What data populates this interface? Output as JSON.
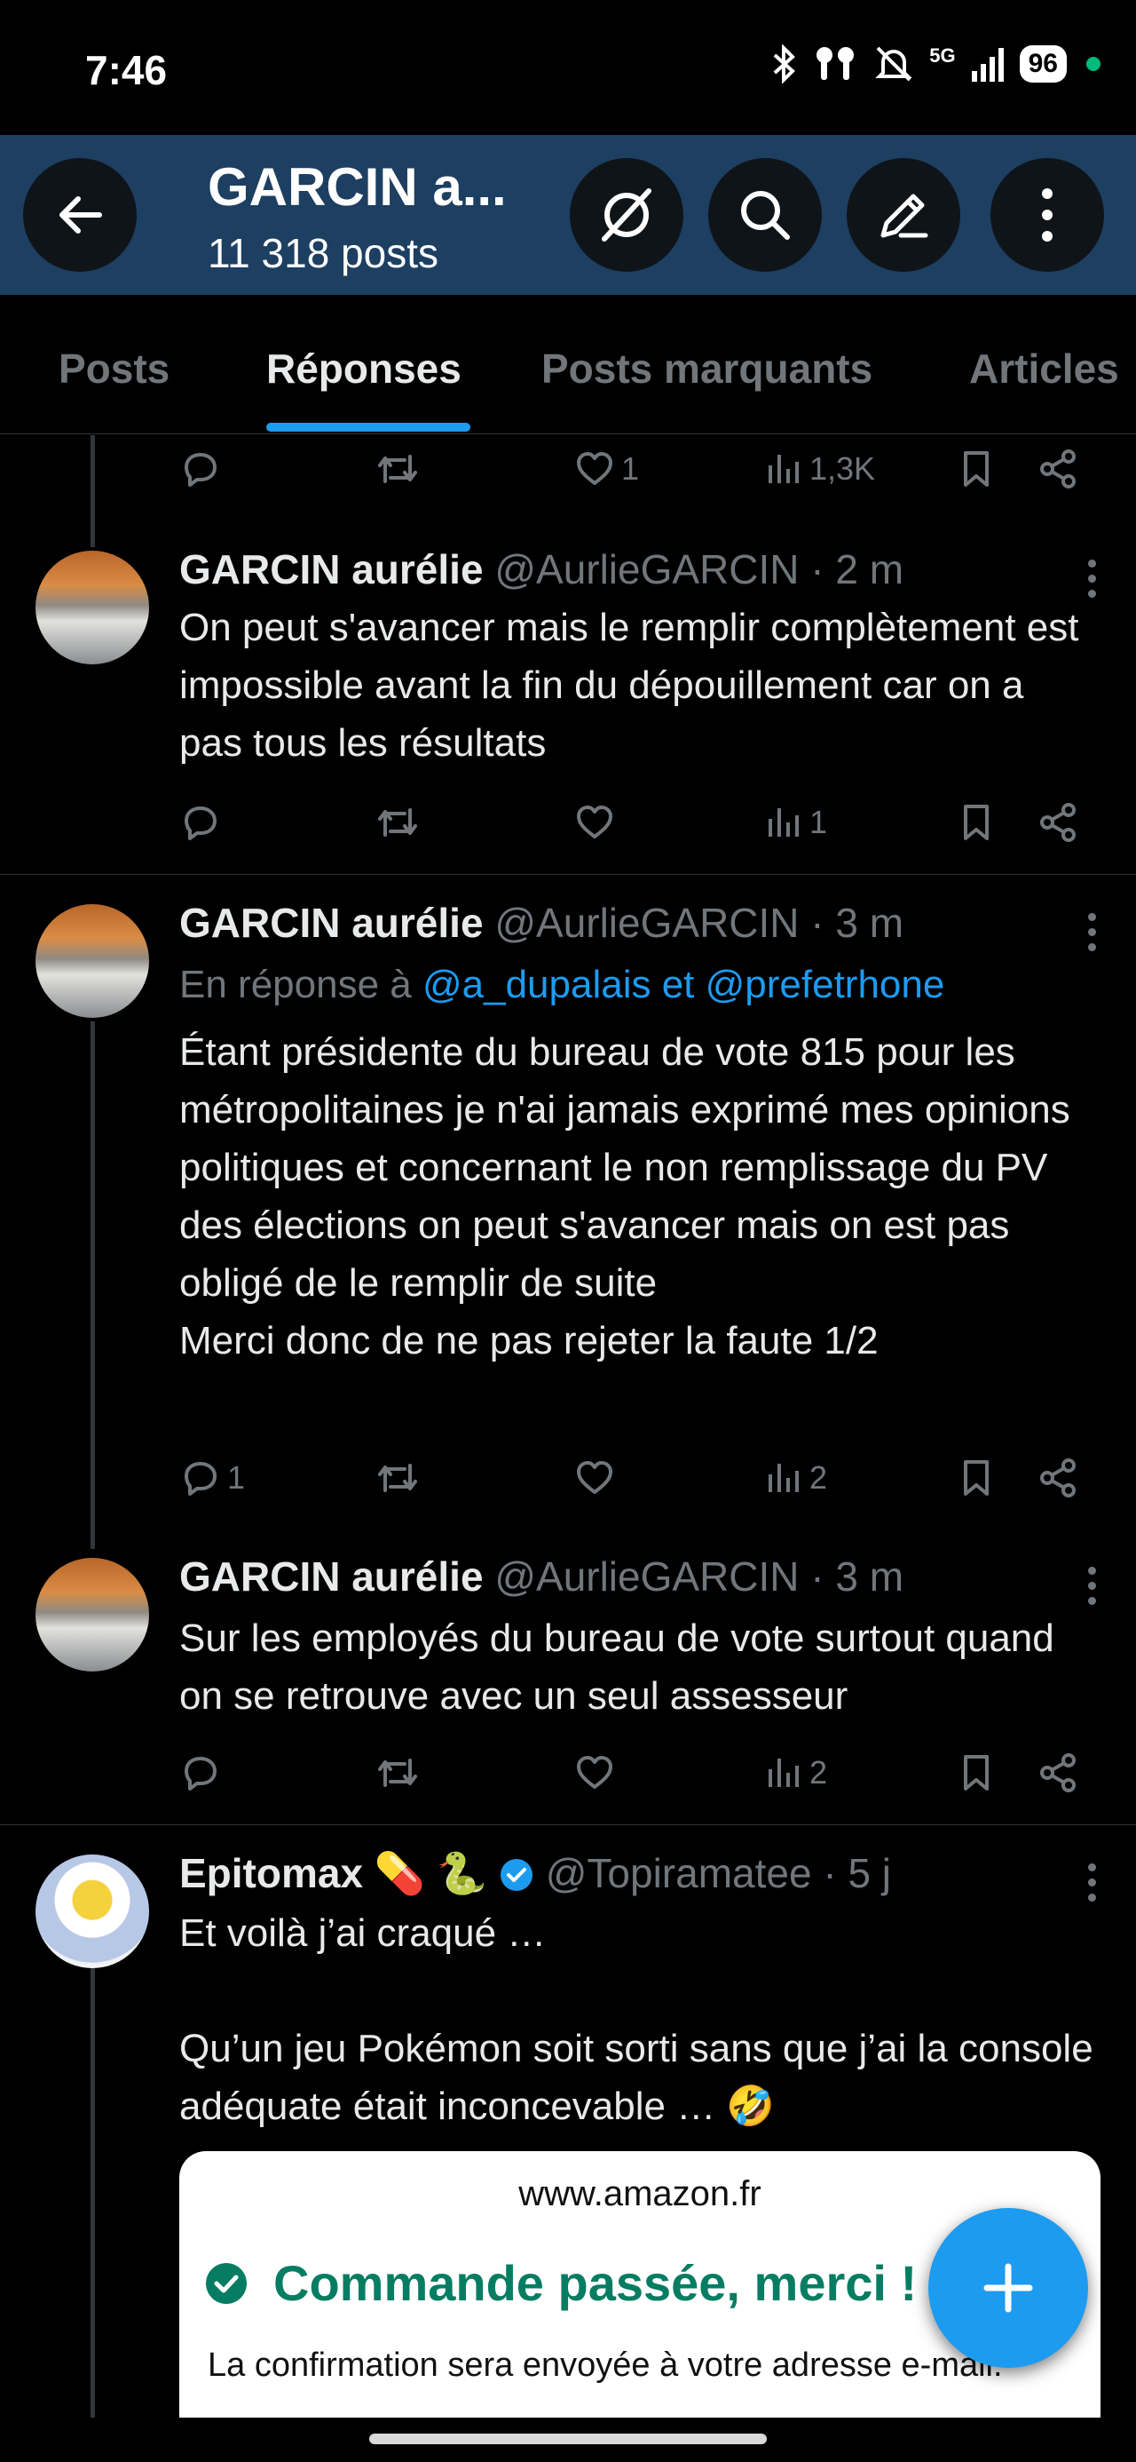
{
  "status_bar": {
    "time": "7:46",
    "network": "5G",
    "battery": "96",
    "icons": [
      "bluetooth-icon",
      "earbuds-icon",
      "mute-icon",
      "signal-icon",
      "battery-icon"
    ]
  },
  "header": {
    "title": "GARCIN a...",
    "post_count": "11 318 posts",
    "buttons": [
      "back-icon",
      "grok-icon",
      "search-icon",
      "edit-icon",
      "more-vertical-icon"
    ]
  },
  "tabs": [
    {
      "label": "Posts",
      "active": false
    },
    {
      "label": "Réponses",
      "active": true
    },
    {
      "label": "Posts marquants",
      "active": false
    },
    {
      "label": "Articles",
      "active": false
    }
  ],
  "top_actions": {
    "replies": "",
    "reposts": "",
    "likes": "1",
    "views": "1,3K"
  },
  "posts": [
    {
      "name": "GARCIN aurélie",
      "handle": "@AurlieGARCIN",
      "time": "· 2 m",
      "text": "On peut s'avancer mais le remplir complètement est impossible avant la fin du dépouillement car on a pas tous les résultats",
      "actions": {
        "replies": "",
        "reposts": "",
        "likes": "",
        "views": "1"
      }
    },
    {
      "name": "GARCIN aurélie",
      "handle": "@AurlieGARCIN",
      "time": "· 3 m",
      "reply_prefix": "En réponse à ",
      "reply_targets": "@a_dupalais et @prefetrhone",
      "text": "Étant présidente du bureau de vote 815 pour les métropolitaines je n'ai jamais exprimé mes opinions politiques et concernant le non remplissage du PV des élections on peut s'avancer mais on est pas obligé de le remplir de suite\nMerci donc de ne pas rejeter la faute 1/2",
      "actions": {
        "replies": "1",
        "reposts": "",
        "likes": "",
        "views": "2"
      }
    },
    {
      "name": "GARCIN aurélie",
      "handle": "@AurlieGARCIN",
      "time": "· 3 m",
      "text": "Sur les employés du bureau de vote surtout quand on se retrouve avec un seul assesseur",
      "actions": {
        "replies": "",
        "reposts": "",
        "likes": "",
        "views": "2"
      }
    },
    {
      "name": "Epitomax 💊 🐍",
      "handle": "@Topiramatee",
      "time": "· 5 j",
      "verified": true,
      "text": "Et voilà j’ai craqué …\n\nQu’un jeu Pokémon soit sorti sans que j’ai la console adéquate était inconcevable … 🤣",
      "card": {
        "domain": "www.amazon.fr",
        "title": "Commande passée, merci !",
        "confirmation": "La confirmation sera envoyée à votre adresse e-mail."
      }
    }
  ],
  "colors": {
    "background": "#000000",
    "header": "#1d3f61",
    "accent": "#1d9bf0",
    "muted": "#71767b",
    "amazon_green": "#067d62"
  }
}
